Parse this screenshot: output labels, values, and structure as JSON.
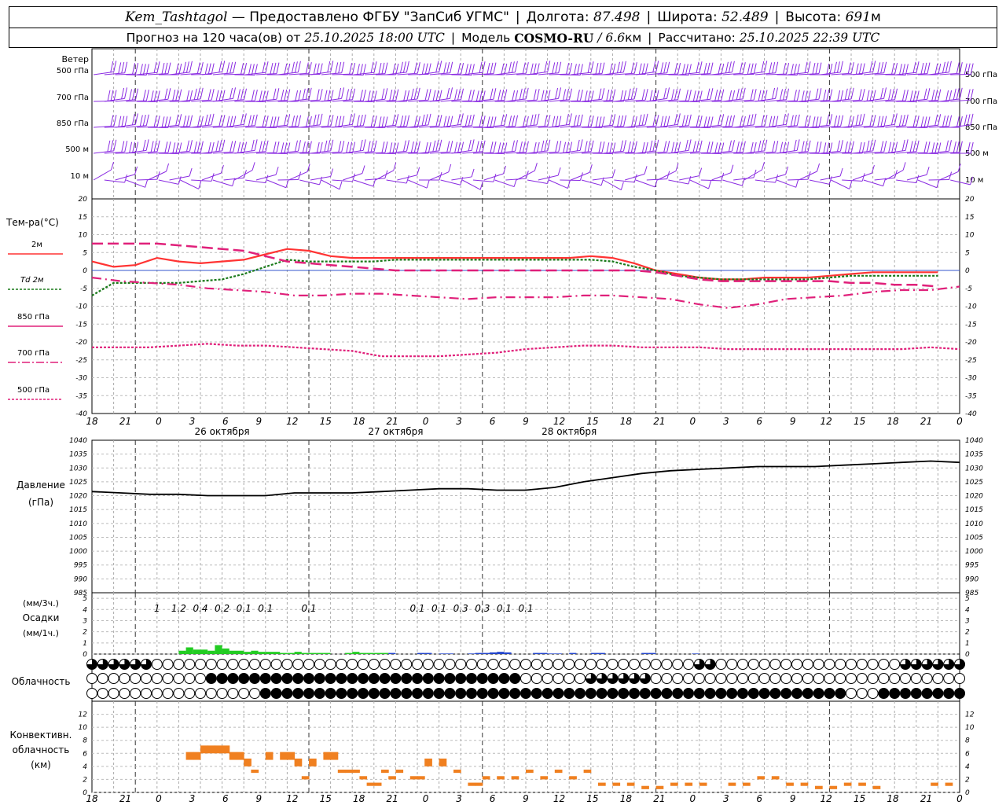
{
  "header": {
    "station": "Kem_Tashtagol",
    "provided_by": "— Предоставлено ФГБУ \"ЗапСиб УГМС\"",
    "lon_label": "Долгота:",
    "lon_value": "87.498",
    "lat_label": "Широта:",
    "lat_value": "52.489",
    "alt_label": "Высота:",
    "alt_value": "691",
    "alt_unit": "м",
    "forecast_text": "Прогноз на 120 часа(ов) от",
    "forecast_time": "25.10.2025 18:00 UTC",
    "model_label": "Модель",
    "model_name": "COSMO-RU",
    "model_res": "/ 6.6",
    "model_res_unit": "км",
    "calc_label": "Рассчитано:",
    "calc_time": "25.10.2025 22:39 UTC"
  },
  "colors": {
    "wind": "#8a2be2",
    "t2m": "#ff3333",
    "td2m": "#1a7a1a",
    "t850": "#e0207a",
    "t700": "#e0207a",
    "t500": "#e0207a",
    "precip": "#22cc22",
    "precip_snow": "#2244cc",
    "convective": "#f08020",
    "grid": "#999999"
  },
  "x_axis": {
    "hour_labels": [
      "18",
      "21",
      "0",
      "3",
      "6",
      "9",
      "12",
      "15",
      "18",
      "21",
      "0",
      "3",
      "6",
      "9",
      "12",
      "15",
      "18",
      "21",
      "0",
      "3",
      "6",
      "9",
      "12",
      "15",
      "18",
      "21",
      "0"
    ],
    "day_labels": [
      "26 октября",
      "27 октября",
      "28 октября"
    ]
  },
  "wind_panel": {
    "title": "Ветер",
    "levels": [
      "500 гПа",
      "700 гПа",
      "850 гПа",
      "500 м",
      "10  м"
    ]
  },
  "temp_panel": {
    "title": "Тем-ра(°С)",
    "legend": [
      "2м",
      "Td  2м",
      "850 гПа",
      "700 гПа",
      "500 гПа"
    ]
  },
  "pressure_panel": {
    "title": "Давление",
    "unit": "(гПа)"
  },
  "precip_panel": {
    "unit_3h": "(мм/3ч.)",
    "title": "Осадки",
    "unit_1h": "(мм/1ч.)",
    "labels": [
      {
        "h": 9,
        "text": "1"
      },
      {
        "h": 12,
        "text": "1.2"
      },
      {
        "h": 15,
        "text": "0.4"
      },
      {
        "h": 18,
        "text": "0.2"
      },
      {
        "h": 21,
        "text": "0.1"
      },
      {
        "h": 24,
        "text": "0.1"
      },
      {
        "h": 30,
        "text": "0.1"
      },
      {
        "h": 45,
        "text": "0.1"
      },
      {
        "h": 48,
        "text": "0.1"
      },
      {
        "h": 51,
        "text": "0.3"
      },
      {
        "h": 54,
        "text": "0.3"
      },
      {
        "h": 57,
        "text": "0.1"
      },
      {
        "h": 60,
        "text": "0.1"
      }
    ]
  },
  "cloud_panel": {
    "title": "Облачность"
  },
  "conv_panel": {
    "title1": "Конвективн.",
    "title2": "облачность",
    "unit": "(км)"
  },
  "chart_data": [
    {
      "type": "line",
      "title": "Тем-ра(°С)",
      "x_unit": "hours since 25.10.2025 18:00 UTC",
      "ylim": [
        -40,
        20
      ],
      "grid": true,
      "series": [
        {
          "name": "2м",
          "x": [
            0,
            2,
            4,
            6,
            8,
            10,
            12,
            14,
            16,
            18,
            20,
            22,
            24,
            26,
            28,
            30,
            32,
            34,
            36,
            38,
            40,
            42,
            44,
            46,
            48,
            50,
            52,
            54,
            56,
            58,
            60,
            62,
            64,
            66,
            68,
            70,
            72,
            74,
            76,
            78
          ],
          "values": [
            2.5,
            1,
            1.5,
            3.5,
            2.5,
            2,
            2.5,
            3,
            4.5,
            6,
            5.5,
            4,
            3.5,
            3.5,
            3.5,
            3.5,
            3.5,
            3.5,
            3.5,
            3.5,
            3.5,
            3.5,
            3.5,
            4,
            3.5,
            2,
            0,
            -1,
            -2,
            -2.5,
            -2.5,
            -2,
            -2,
            -2,
            -1.5,
            -1,
            -0.5,
            -0.5,
            -0.5,
            -0.5
          ]
        },
        {
          "name": "Td  2м",
          "x": [
            0,
            2,
            4,
            6,
            8,
            10,
            12,
            14,
            16,
            18,
            20,
            22,
            24,
            26,
            28,
            30,
            32,
            34,
            36,
            38,
            40,
            42,
            44,
            46,
            48,
            50,
            52,
            54,
            56,
            58,
            60,
            62,
            64,
            66,
            68,
            70,
            72,
            74,
            76,
            78
          ],
          "values": [
            -7,
            -3.5,
            -3.5,
            -3.5,
            -3.5,
            -3,
            -2.5,
            -1,
            1,
            3,
            2.5,
            2.5,
            2.5,
            2.5,
            3,
            3,
            3,
            3,
            3,
            3,
            3,
            3,
            3,
            3,
            2.5,
            1,
            0,
            -1.5,
            -2,
            -2.5,
            -2.5,
            -2.5,
            -2.5,
            -2.5,
            -2,
            -1.5,
            -1.5,
            -1.5,
            -1.5,
            -1.5
          ]
        },
        {
          "name": "850 гПа",
          "x": [
            0,
            2,
            4,
            6,
            8,
            10,
            12,
            14,
            16,
            18,
            20,
            22,
            24,
            26,
            28,
            30,
            32,
            34,
            36,
            38,
            40,
            42,
            44,
            46,
            48,
            50,
            52,
            54,
            56,
            58,
            60,
            62,
            64,
            66,
            68,
            70,
            72,
            74,
            76,
            78
          ],
          "values": [
            7.5,
            7.5,
            7.5,
            7.5,
            7,
            6.5,
            6,
            5.5,
            4,
            2.5,
            2,
            1.5,
            1,
            0.5,
            0,
            0,
            0,
            0,
            0,
            0,
            0,
            0,
            0,
            0,
            0,
            0,
            -0.5,
            -1.5,
            -2.5,
            -3,
            -3,
            -3,
            -3,
            -3,
            -3,
            -3.5,
            -3.5,
            -4,
            -4,
            -4.5
          ]
        },
        {
          "name": "700 гПа",
          "x": [
            0,
            4,
            8,
            12,
            16,
            20,
            24,
            28,
            32,
            36,
            40,
            44,
            48,
            52,
            56,
            60,
            64,
            68,
            72,
            76,
            80,
            84,
            88,
            92,
            96,
            100,
            104,
            108,
            112,
            116,
            120
          ],
          "values": [
            -2,
            -3,
            -3.5,
            -4,
            -5,
            -5.5,
            -6,
            -7,
            -7,
            -6.5,
            -6.5,
            -7,
            -7.5,
            -8,
            -7.5,
            -7.5,
            -7.5,
            -7,
            -7,
            -7.5,
            -8,
            -9.5,
            -10.5,
            -9.5,
            -8,
            -7.5,
            -7,
            -6,
            -5.5,
            -5.5,
            -4.5
          ]
        },
        {
          "name": "500 гПа",
          "x": [
            0,
            4,
            8,
            12,
            16,
            20,
            24,
            28,
            32,
            36,
            40,
            44,
            48,
            52,
            56,
            60,
            64,
            68,
            72,
            76,
            80,
            84,
            88,
            92,
            96,
            100,
            104,
            108,
            112,
            116,
            120
          ],
          "values": [
            -21.5,
            -21.5,
            -21.5,
            -21,
            -20.5,
            -21,
            -21,
            -21.5,
            -22,
            -22.5,
            -24,
            -24,
            -24,
            -23.5,
            -23,
            -22,
            -21.5,
            -21,
            -21,
            -21.5,
            -21.5,
            -21.5,
            -22,
            -22,
            -22,
            -22,
            -22,
            -22,
            -22,
            -21.5,
            -22
          ]
        }
      ]
    },
    {
      "type": "line",
      "title": "Давление",
      "ylabel": "(гПа)",
      "ylim": [
        985,
        1040
      ],
      "grid": true,
      "x": [
        0,
        4,
        8,
        12,
        16,
        20,
        24,
        28,
        32,
        36,
        40,
        44,
        48,
        52,
        56,
        60,
        64,
        68,
        72,
        76,
        80,
        84,
        88,
        92,
        96,
        100,
        104,
        108,
        112,
        116,
        120
      ],
      "values": [
        1021.5,
        1021,
        1020.5,
        1020.5,
        1020,
        1020,
        1020,
        1021,
        1021,
        1021,
        1021.5,
        1022,
        1022.5,
        1022.5,
        1022,
        1022,
        1023,
        1025,
        1026.5,
        1028,
        1029,
        1029.5,
        1030,
        1030.5,
        1030.5,
        1030.5,
        1031,
        1031.5,
        1032,
        1032.5,
        1032
      ]
    },
    {
      "type": "bar",
      "title": "Осадки",
      "ylabel": "(мм/1ч.)",
      "ylim": [
        0,
        5
      ],
      "x": [
        12,
        13,
        14,
        15,
        16,
        17,
        18,
        19,
        20,
        21,
        22,
        23,
        24,
        25,
        26,
        27,
        28,
        29,
        30,
        31,
        32,
        35,
        36,
        37,
        38,
        39,
        40,
        41,
        45,
        46,
        48,
        49,
        52,
        53,
        54,
        55,
        56,
        57,
        61,
        62,
        63,
        64,
        66,
        69,
        70,
        76,
        77,
        83
      ],
      "values": [
        0.3,
        0.6,
        0.4,
        0.4,
        0.3,
        0.8,
        0.5,
        0.3,
        0.3,
        0.2,
        0.3,
        0.2,
        0.2,
        0.2,
        0.1,
        0.1,
        0.2,
        0.1,
        0.1,
        0.1,
        0.1,
        0.1,
        0.2,
        0.1,
        0.1,
        0.1,
        0.1,
        0.1,
        0.1,
        0.1,
        0.05,
        0.05,
        0.05,
        0.1,
        0.1,
        0.15,
        0.2,
        0.15,
        0.1,
        0.1,
        0.05,
        0.05,
        0.1,
        0.1,
        0.1,
        0.1,
        0.1,
        0.05
      ]
    },
    {
      "type": "bar",
      "title": "Конвективн. облачность",
      "ylabel": "(км)",
      "ylim": [
        0,
        13
      ],
      "x": [
        13,
        14,
        15,
        16,
        17,
        18,
        19,
        20,
        21,
        22,
        24,
        26,
        27,
        28,
        29,
        30,
        32,
        33,
        34,
        35,
        36,
        37,
        38,
        39,
        40,
        41,
        42,
        44,
        45,
        46,
        48,
        50,
        52,
        53,
        54,
        56,
        58,
        60,
        62,
        64,
        66,
        68,
        70,
        72,
        74,
        76,
        78,
        80,
        82,
        84,
        88,
        90,
        92,
        94,
        96,
        98,
        100,
        102,
        104,
        106,
        108,
        116,
        118
      ],
      "values": [
        5,
        5,
        6,
        6,
        6,
        6,
        5,
        5,
        4,
        3,
        5,
        5,
        5,
        4,
        2,
        4,
        5,
        5,
        3,
        3,
        3,
        2,
        1,
        1,
        3,
        2,
        3,
        2,
        2,
        4,
        4,
        3,
        1,
        1,
        2,
        2,
        2,
        3,
        2,
        3,
        2,
        3,
        1,
        1,
        1,
        0.5,
        0.5,
        1,
        1,
        1,
        1,
        1,
        2,
        2,
        1,
        1,
        0.5,
        0.5,
        1,
        1,
        0.5,
        1,
        1
      ]
    }
  ]
}
